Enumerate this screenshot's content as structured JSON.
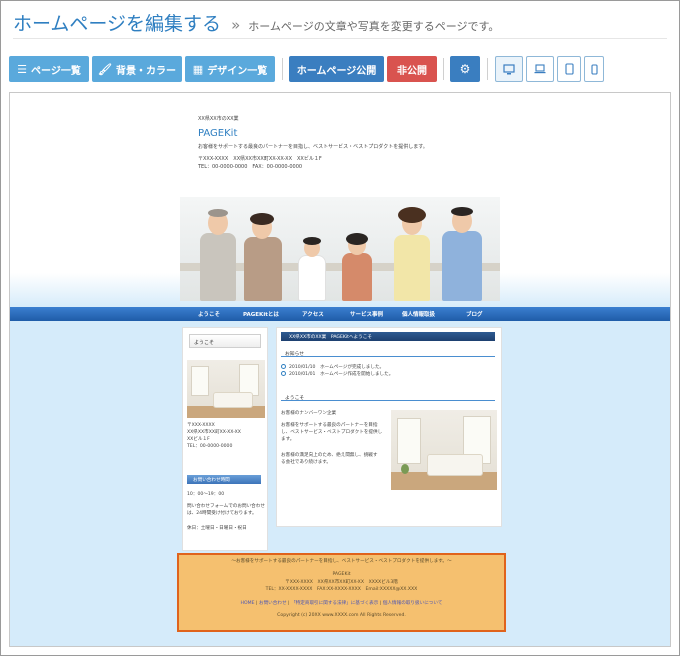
{
  "header": {
    "title": "ホームページを編集する",
    "separator": "»",
    "subtitle": "ホームページの文章や写真を変更するページです。"
  },
  "toolbar": {
    "page_list": "ページ一覧",
    "background_color": "背景・カラー",
    "design_list": "デザイン一覧",
    "publish": "ホームページ公開",
    "unpublish": "非公開",
    "icons": {
      "page_list": "list-icon",
      "background_color": "brush-icon",
      "design_list": "grid-icon",
      "settings": "gear-icon",
      "desktop": "desktop-icon",
      "laptop": "laptop-icon",
      "tablet": "tablet-icon",
      "phone": "phone-icon"
    }
  },
  "preview": {
    "company_location": "XX県XX市のXX業",
    "site_name": "PAGEKit",
    "description": "お客様をサポートする最良のパートナーを目指し、ベストサービス・ベストプロダクトを提供します。",
    "address": "〒XXX-XXXX　XX県XX市XX町XX-XX-XX　XXビル１F",
    "tel_fax": "TEL：00-0000-0000　FAX：00-0000-0000",
    "nav": [
      "ようこそ",
      "PAGEKitとは",
      "アクセス",
      "サービス事例",
      "個人情報取扱",
      "ブログ"
    ],
    "sidebar": {
      "welcome": "ようこそ",
      "zip": "〒XXX-XXXX",
      "addr1": "XX県XX市XX町XX-XX-XX",
      "addr2": "XXビル１F",
      "tel": "TEL：00-0000-0000",
      "contact_heading": "お問い合わせ時間",
      "hours": "10：00～19：00",
      "note1": "問い合わせフォームでのお問い合わせ",
      "note2": "は、24時間受け付けております。",
      "holiday": "休日：土曜日・日曜日・祝日"
    },
    "main": {
      "heading": "XX県XX市のXX業　PAGEKitへようこそ",
      "news_title": "お知らせ",
      "news": [
        "2010/01/10　ホームページが完成しました。",
        "2010/01/01　ホームページ作成を開始しました。"
      ],
      "welcome_title": "ようこそ",
      "p1": "お客様のナンバーワン企業",
      "p2a": "お客様をサポートする最良のパートナーを目指",
      "p2b": "し、ベストサービス・ベストプロダクトを提供し",
      "p2c": "ます。",
      "p3a": "お客様の満足向上のため、絶え間無し、挑戦す",
      "p3b": "る会社であり続けます。"
    },
    "footer": {
      "tagline": "～お客様をサポートする最良のパートナーを目指し、ベストサービス・ベストプロダクトを提供します。～",
      "company": "PAGEKit",
      "address": "〒XXX-XXXX　XX県XX市XX町XX-XX　XXXXビル3階",
      "contact": "TEL：XX-XXXX-XXXX　FAX:XX-XXXX-XXXX　Email:XXXXX@XX.XXX",
      "links": [
        "HOME",
        "お問い合わせ",
        "「特定商取引に関する法律」に基づく表示",
        "個人情報の取り扱いについて"
      ],
      "link_sep": "|",
      "copyright": "Copyright (c) 20XX www.XXXX.com All Rights Reserved."
    }
  },
  "colors": {
    "accent": "#2f7fc1",
    "toolbar_light": "#5aa9dc",
    "toolbar_dark": "#3a7ec0",
    "danger": "#d9534f",
    "footer_bg": "#f5c06f",
    "footer_border": "#e0631c",
    "preview_bg": "#d5ebfa"
  }
}
